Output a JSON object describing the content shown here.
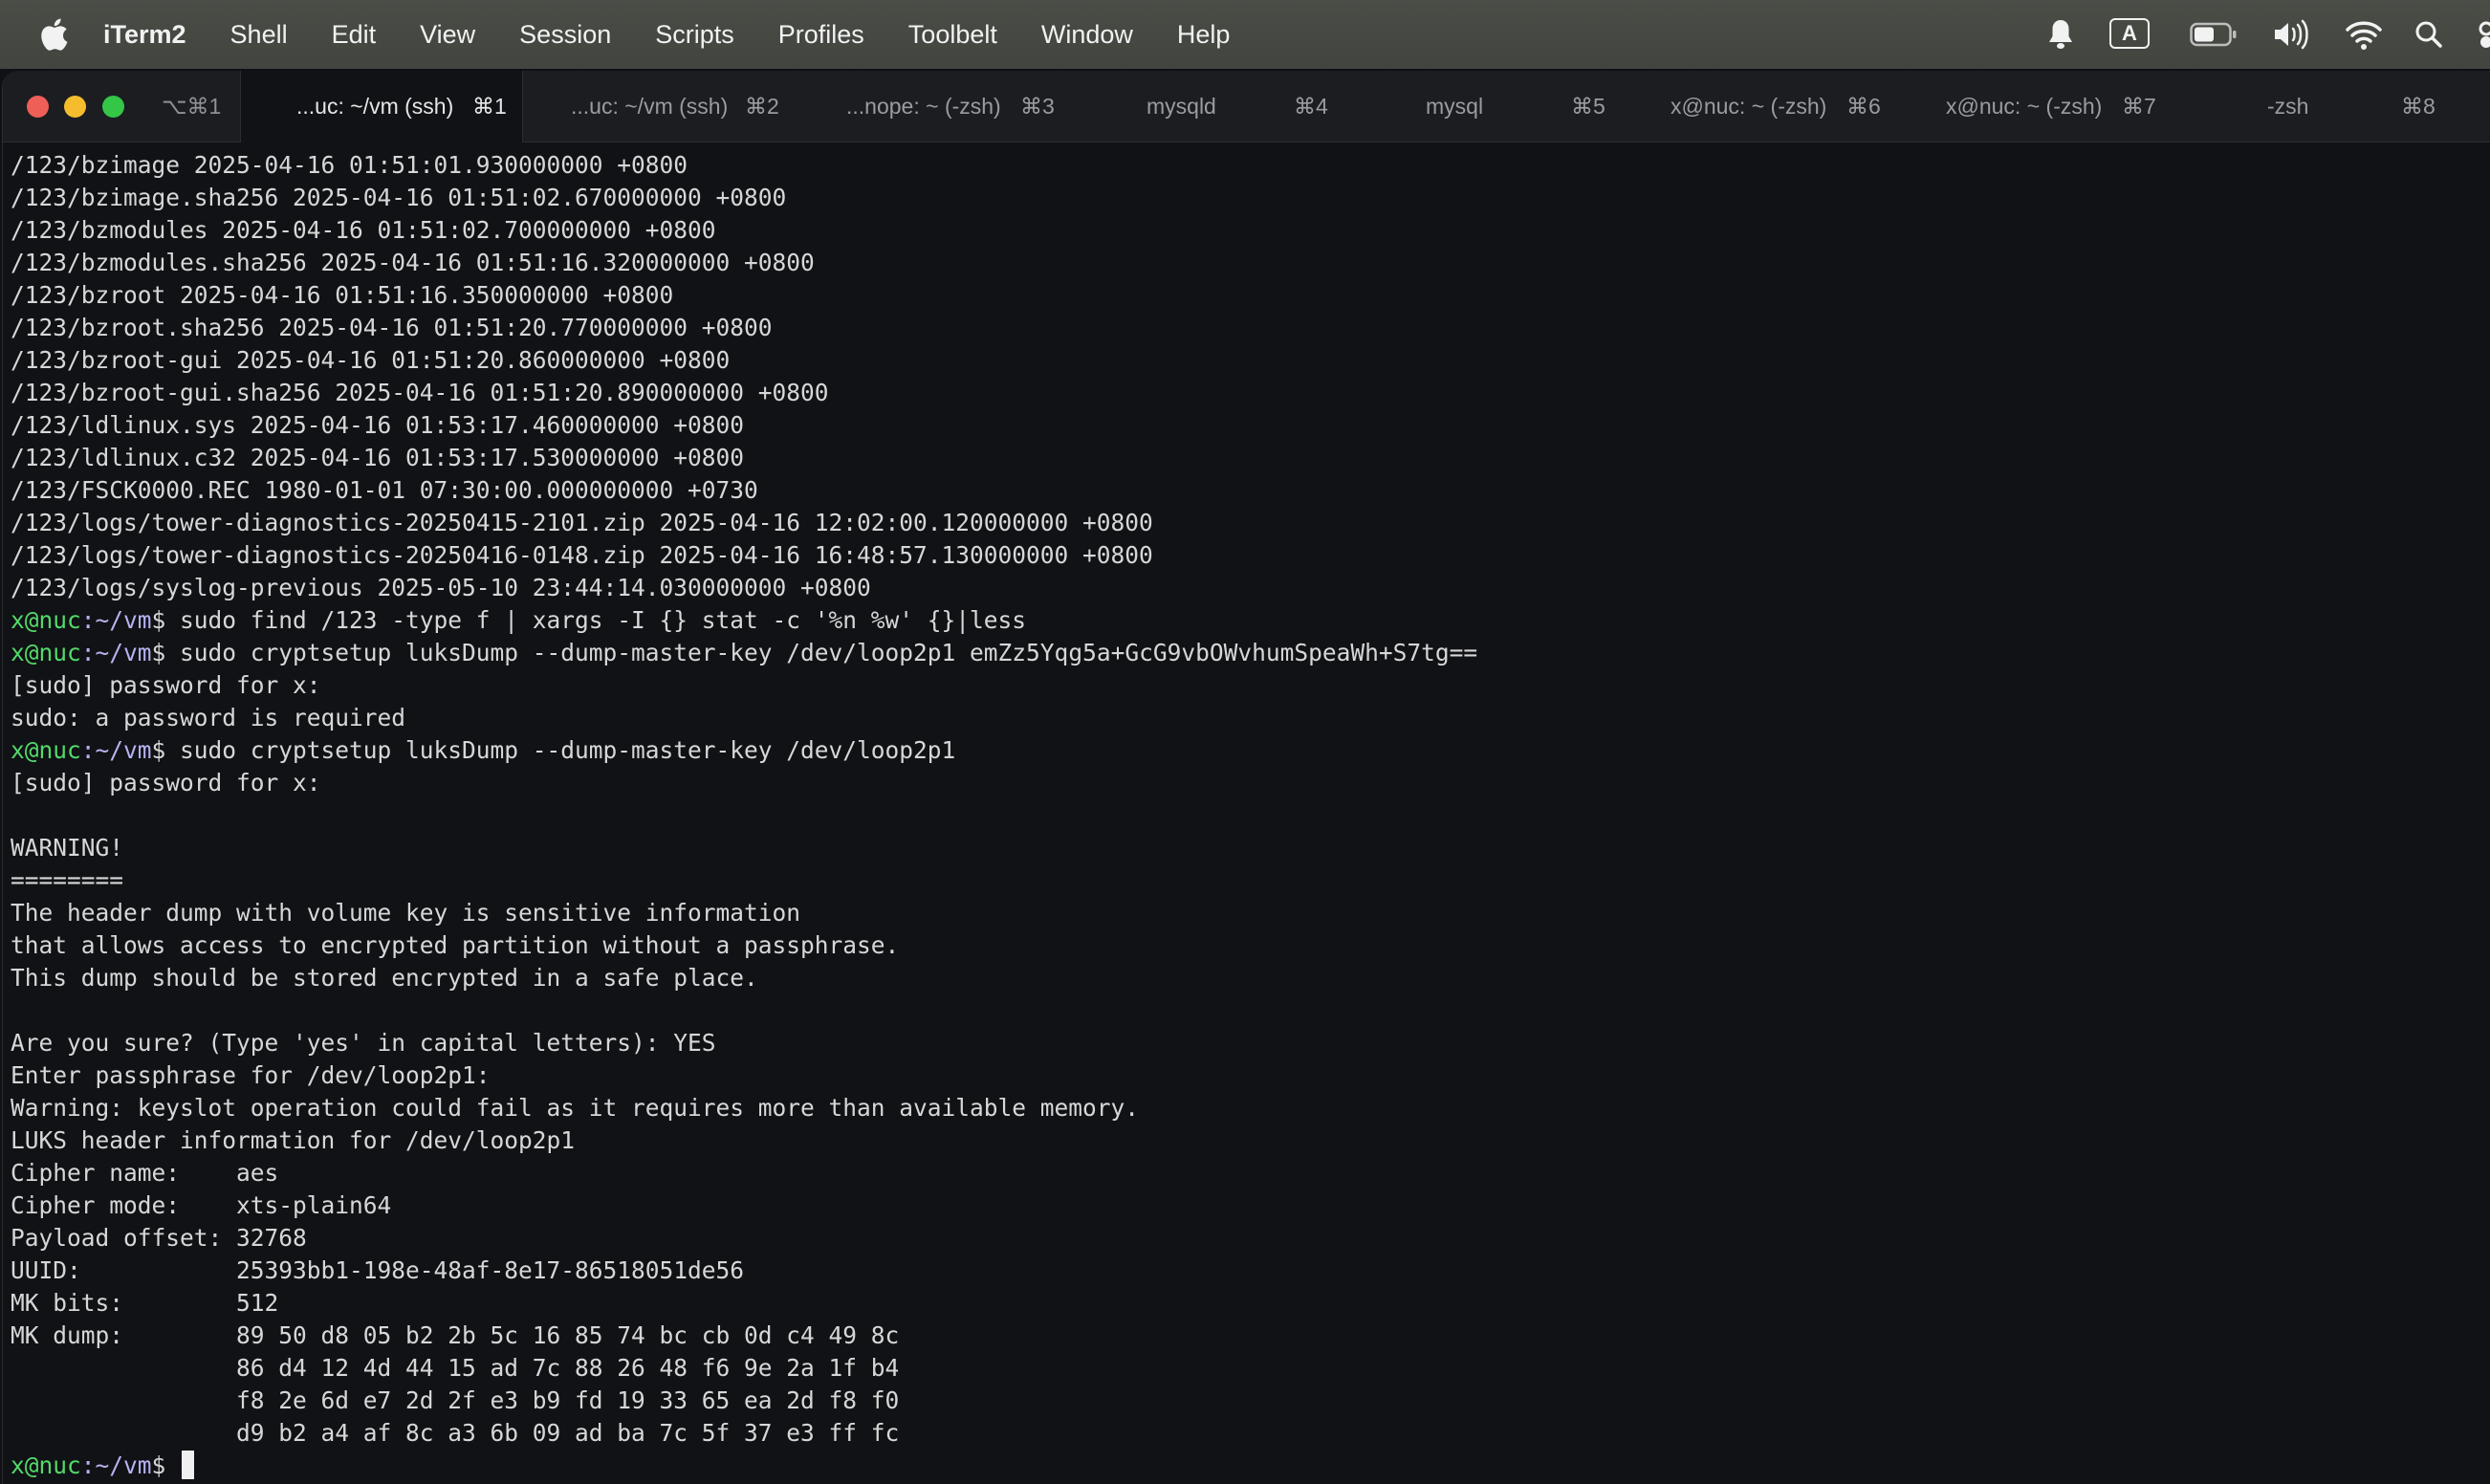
{
  "menubar": {
    "app_name": "iTerm2",
    "items": [
      "Shell",
      "Edit",
      "View",
      "Session",
      "Scripts",
      "Profiles",
      "Toolbelt",
      "Window",
      "Help"
    ],
    "input_source": "A",
    "status_icons": [
      "bell-icon",
      "input-source-icon",
      "battery-icon",
      "volume-icon",
      "wifi-icon",
      "search-icon",
      "control-center-icon"
    ]
  },
  "window": {
    "first_shortcut": "⌥⌘1",
    "tabs": [
      {
        "title": "...uc: ~/vm (ssh)",
        "shortcut": "⌘1",
        "active": true
      },
      {
        "title": "...uc: ~/vm (ssh)",
        "shortcut": "⌘2",
        "active": false
      },
      {
        "title": "...nope: ~ (-zsh)",
        "shortcut": "⌘3",
        "active": false
      },
      {
        "title": "mysqld",
        "shortcut": "⌘4",
        "active": false
      },
      {
        "title": "mysql",
        "shortcut": "⌘5",
        "active": false
      },
      {
        "title": "x@nuc: ~ (-zsh)",
        "shortcut": "⌘6",
        "active": false
      },
      {
        "title": "x@nuc: ~ (-zsh)",
        "shortcut": "⌘7",
        "active": false
      },
      {
        "title": "-zsh",
        "shortcut": "⌘8",
        "active": false
      }
    ]
  },
  "terminal": {
    "prompt": {
      "user": "x@nuc",
      "path": ":~/vm",
      "symbol": "$"
    },
    "lines": [
      {
        "text": "/123/bzimage 2025-04-16 01:51:01.930000000 +0800"
      },
      {
        "text": "/123/bzimage.sha256 2025-04-16 01:51:02.670000000 +0800"
      },
      {
        "text": "/123/bzmodules 2025-04-16 01:51:02.700000000 +0800"
      },
      {
        "text": "/123/bzmodules.sha256 2025-04-16 01:51:16.320000000 +0800"
      },
      {
        "text": "/123/bzroot 2025-04-16 01:51:16.350000000 +0800"
      },
      {
        "text": "/123/bzroot.sha256 2025-04-16 01:51:20.770000000 +0800"
      },
      {
        "text": "/123/bzroot-gui 2025-04-16 01:51:20.860000000 +0800"
      },
      {
        "text": "/123/bzroot-gui.sha256 2025-04-16 01:51:20.890000000 +0800"
      },
      {
        "text": "/123/ldlinux.sys 2025-04-16 01:53:17.460000000 +0800"
      },
      {
        "text": "/123/ldlinux.c32 2025-04-16 01:53:17.530000000 +0800"
      },
      {
        "text": "/123/FSCK0000.REC 1980-01-01 07:30:00.000000000 +0730"
      },
      {
        "text": "/123/logs/tower-diagnostics-20250415-2101.zip 2025-04-16 12:02:00.120000000 +0800"
      },
      {
        "text": "/123/logs/tower-diagnostics-20250416-0148.zip 2025-04-16 16:48:57.130000000 +0800"
      },
      {
        "text": "/123/logs/syslog-previous 2025-05-10 23:44:14.030000000 +0800"
      },
      {
        "prompt": true,
        "text": " sudo find /123 -type f | xargs -I {} stat -c '%n %w' {}|less"
      },
      {
        "prompt": true,
        "text": " sudo cryptsetup luksDump --dump-master-key /dev/loop2p1 emZz5Yqg5a+GcG9vbOWvhumSpeaWh+S7tg=="
      },
      {
        "text": "[sudo] password for x:"
      },
      {
        "text": "sudo: a password is required"
      },
      {
        "prompt": true,
        "text": " sudo cryptsetup luksDump --dump-master-key /dev/loop2p1"
      },
      {
        "text": "[sudo] password for x:"
      },
      {
        "text": ""
      },
      {
        "text": "WARNING!"
      },
      {
        "text": "========"
      },
      {
        "text": "The header dump with volume key is sensitive information"
      },
      {
        "text": "that allows access to encrypted partition without a passphrase."
      },
      {
        "text": "This dump should be stored encrypted in a safe place."
      },
      {
        "text": ""
      },
      {
        "text": "Are you sure? (Type 'yes' in capital letters): YES"
      },
      {
        "text": "Enter passphrase for /dev/loop2p1:"
      },
      {
        "text": "Warning: keyslot operation could fail as it requires more than available memory."
      },
      {
        "text": "LUKS header information for /dev/loop2p1"
      },
      {
        "text": "Cipher name:    aes"
      },
      {
        "text": "Cipher mode:    xts-plain64"
      },
      {
        "text": "Payload offset: 32768"
      },
      {
        "text": "UUID:           25393bb1-198e-48af-8e17-86518051de56"
      },
      {
        "text": "MK bits:        512"
      },
      {
        "text": "MK dump:        89 50 d8 05 b2 2b 5c 16 85 74 bc cb 0d c4 49 8c"
      },
      {
        "text": "                86 d4 12 4d 44 15 ad 7c 88 26 48 f6 9e 2a 1f b4"
      },
      {
        "text": "                f8 2e 6d e7 2d 2f e3 b9 fd 19 33 65 ea 2d f8 f0"
      },
      {
        "text": "                d9 b2 a4 af 8c a3 6b 09 ad ba 7c 5f 37 e3 ff fc"
      },
      {
        "prompt": true,
        "text": " ",
        "cursor": true
      }
    ]
  }
}
